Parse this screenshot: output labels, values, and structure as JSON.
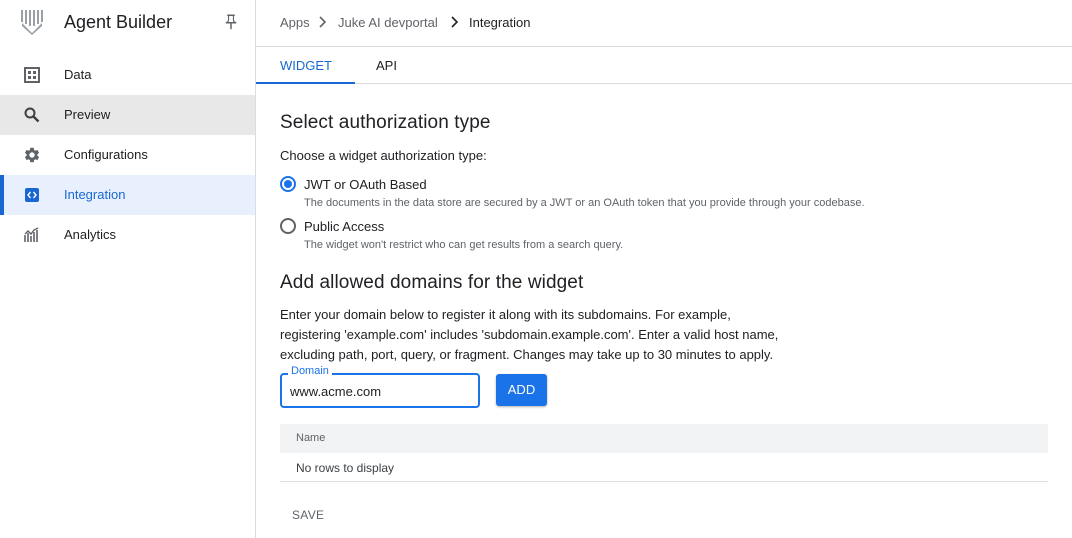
{
  "app": {
    "title": "Agent Builder"
  },
  "sidebar": {
    "items": [
      {
        "label": "Data",
        "icon": "table-icon"
      },
      {
        "label": "Preview",
        "icon": "search-icon"
      },
      {
        "label": "Configurations",
        "icon": "gear-icon"
      },
      {
        "label": "Integration",
        "icon": "code-icon"
      },
      {
        "label": "Analytics",
        "icon": "analytics-icon"
      }
    ],
    "hovered": "Preview",
    "active": "Integration"
  },
  "breadcrumb": [
    "Apps",
    "Juke AI devportal",
    "Integration"
  ],
  "tabs": [
    "WIDGET",
    "API"
  ],
  "active_tab": "WIDGET",
  "auth": {
    "heading": "Select authorization type",
    "prompt": "Choose a widget authorization type:",
    "options": [
      {
        "label": "JWT or OAuth Based",
        "description": "The documents in the data store are secured by a JWT or an OAuth token that you provide through your codebase.",
        "selected": true
      },
      {
        "label": "Public Access",
        "description": "The widget won't restrict who can get results from a search query.",
        "selected": false
      }
    ]
  },
  "domains": {
    "heading": "Add allowed domains for the widget",
    "description_lines": [
      "Enter your domain below to register it along with its subdomains. For example,",
      "registering 'example.com' includes 'subdomain.example.com'. Enter a valid host name,",
      "excluding path, port, query, or fragment. Changes may take up to 30 minutes to apply."
    ],
    "field_label": "Domain",
    "field_value": "www.acme.com",
    "add_label": "ADD",
    "table": {
      "column": "Name",
      "empty_text": "No rows to display"
    },
    "save_label": "SAVE"
  },
  "colors": {
    "accent": "#1a73e8",
    "active_nav_bg": "#e8f0fe",
    "hover_nav_bg": "#e8e8e8"
  }
}
